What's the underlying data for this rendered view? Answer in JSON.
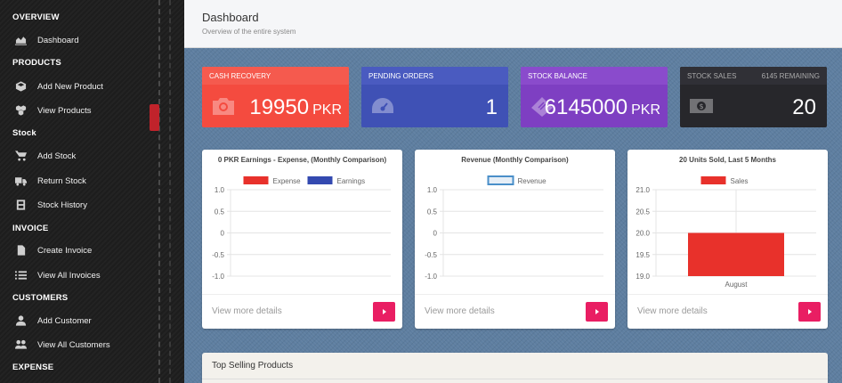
{
  "sidebar": {
    "sections": [
      {
        "title": "OVERVIEW",
        "items": [
          {
            "label": "Dashboard",
            "icon": "area-chart-icon"
          }
        ]
      },
      {
        "title": "PRODUCTS",
        "items": [
          {
            "label": "Add New Product",
            "icon": "cube-icon"
          },
          {
            "label": "View Products",
            "icon": "cubes-icon"
          }
        ]
      },
      {
        "title": "Stock",
        "items": [
          {
            "label": "Add Stock",
            "icon": "cart-icon"
          },
          {
            "label": "Return Stock",
            "icon": "truck-icon"
          },
          {
            "label": "Stock History",
            "icon": "history-icon"
          }
        ]
      },
      {
        "title": "INVOICE",
        "items": [
          {
            "label": "Create Invoice",
            "icon": "file-icon"
          },
          {
            "label": "View All Invoices",
            "icon": "list-icon"
          }
        ]
      },
      {
        "title": "CUSTOMERS",
        "items": [
          {
            "label": "Add Customer",
            "icon": "user-icon"
          },
          {
            "label": "View All Customers",
            "icon": "users-icon"
          }
        ]
      },
      {
        "title": "EXPENSE",
        "items": []
      }
    ]
  },
  "header": {
    "title": "Dashboard",
    "subtitle": "Overview of the entire system"
  },
  "stats": [
    {
      "label": "CASH RECOVERY",
      "extra": "",
      "value": "19950",
      "unit": "PKR",
      "icon": "camera-icon",
      "color": "#f44b3f"
    },
    {
      "label": "PENDING ORDERS",
      "extra": "",
      "value": "1",
      "unit": "",
      "icon": "dashboard-gauge-icon",
      "color": "#3f51b5"
    },
    {
      "label": "STOCK BALANCE",
      "extra": "",
      "value": "6145000",
      "unit": "PKR",
      "icon": "ticket-icon",
      "color": "#7e3fc2"
    },
    {
      "label": "STOCK SALES",
      "extra": "6145 REMAINING",
      "value": "20",
      "unit": "",
      "icon": "money-icon",
      "color": "#27272b"
    }
  ],
  "cards": [
    {
      "title": "0 PKR Earnings - Expense, (Monthly Comparison)",
      "more": "View more details"
    },
    {
      "title": "Revenue (Monthly Comparison)",
      "more": "View more details"
    },
    {
      "title": "20 Units Sold, Last 5 Months",
      "more": "View more details"
    }
  ],
  "chart_data": [
    {
      "type": "bar",
      "title": "0 PKR Earnings - Expense, (Monthly Comparison)",
      "categories": [],
      "series": [
        {
          "name": "Expense",
          "values": [],
          "color": "#e8312b"
        },
        {
          "name": "Earnings",
          "values": [],
          "color": "#3349b0"
        }
      ],
      "yticks": [
        "1.0",
        "0.5",
        "0",
        "-0.5",
        "-1.0"
      ],
      "ylim": [
        -1,
        1
      ],
      "legend": "top",
      "grid": true
    },
    {
      "type": "line",
      "title": "Revenue (Monthly Comparison)",
      "categories": [],
      "series": [
        {
          "name": "Revenue",
          "values": [],
          "color": "#4a8fc9"
        }
      ],
      "yticks": [
        "1.0",
        "0.5",
        "0",
        "-0.5",
        "-1.0"
      ],
      "ylim": [
        -1,
        1
      ],
      "legend": "top",
      "grid": true
    },
    {
      "type": "bar",
      "title": "20 Units Sold, Last 5 Months",
      "categories": [
        "August"
      ],
      "series": [
        {
          "name": "Sales",
          "values": [
            20
          ],
          "color": "#e8312b"
        }
      ],
      "yticks": [
        "21.0",
        "20.5",
        "20.0",
        "19.5",
        "19.0"
      ],
      "ylim": [
        19,
        21
      ],
      "legend": "top",
      "grid": true
    }
  ],
  "bottom_panel": {
    "title": "Top Selling Products"
  }
}
